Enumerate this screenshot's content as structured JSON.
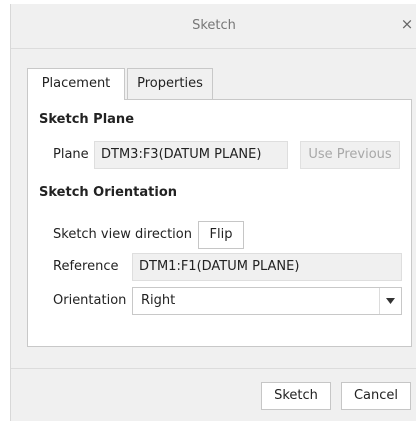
{
  "window": {
    "title": "Sketch",
    "close_glyph": "×",
    "close_icon": "close-icon"
  },
  "tabs": [
    {
      "label": "Placement",
      "active": true
    },
    {
      "label": "Properties",
      "active": false
    }
  ],
  "sketch_plane": {
    "section_title": "Sketch Plane",
    "plane_label": "Plane",
    "plane_value": "DTM3:F3(DATUM PLANE)",
    "use_previous_label": "Use Previous"
  },
  "sketch_orientation": {
    "section_title": "Sketch Orientation",
    "view_direction_label": "Sketch view direction",
    "flip_label": "Flip",
    "reference_label": "Reference",
    "reference_value": "DTM1:F1(DATUM PLANE)",
    "orientation_label": "Orientation",
    "orientation_value": "Right",
    "dropdown_icon": "chevron-down-icon"
  },
  "footer": {
    "sketch_button": "Sketch",
    "cancel_button": "Cancel"
  }
}
